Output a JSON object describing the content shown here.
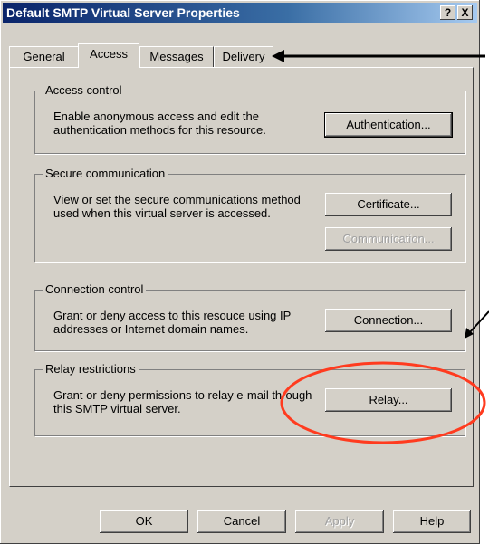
{
  "window": {
    "title": "Default SMTP Virtual Server Properties",
    "help_btn": "?",
    "close_btn": "X"
  },
  "tabs": [
    {
      "label": "General"
    },
    {
      "label": "Access"
    },
    {
      "label": "Messages"
    },
    {
      "label": "Delivery"
    }
  ],
  "groups": {
    "access_control": {
      "legend": "Access control",
      "desc": "Enable anonymous access and edit the authentication methods for this resource.",
      "button": "Authentication..."
    },
    "secure": {
      "legend": "Secure communication",
      "desc": "View or set the secure communications method used when this virtual server is accessed.",
      "button_certificate": "Certificate...",
      "button_communication": "Communication..."
    },
    "connection": {
      "legend": "Connection control",
      "desc": "Grant or deny access to this resouce using IP addresses or Internet domain names.",
      "button": "Connection..."
    },
    "relay": {
      "legend": "Relay restrictions",
      "desc": "Grant or deny permissions to relay e-mail through this SMTP virtual server.",
      "button": "Relay..."
    }
  },
  "footer": {
    "ok": "OK",
    "cancel": "Cancel",
    "apply": "Apply",
    "help": "Help"
  },
  "annotation_colors": {
    "arrow": "#000000",
    "circle": "#ff3b1f"
  }
}
